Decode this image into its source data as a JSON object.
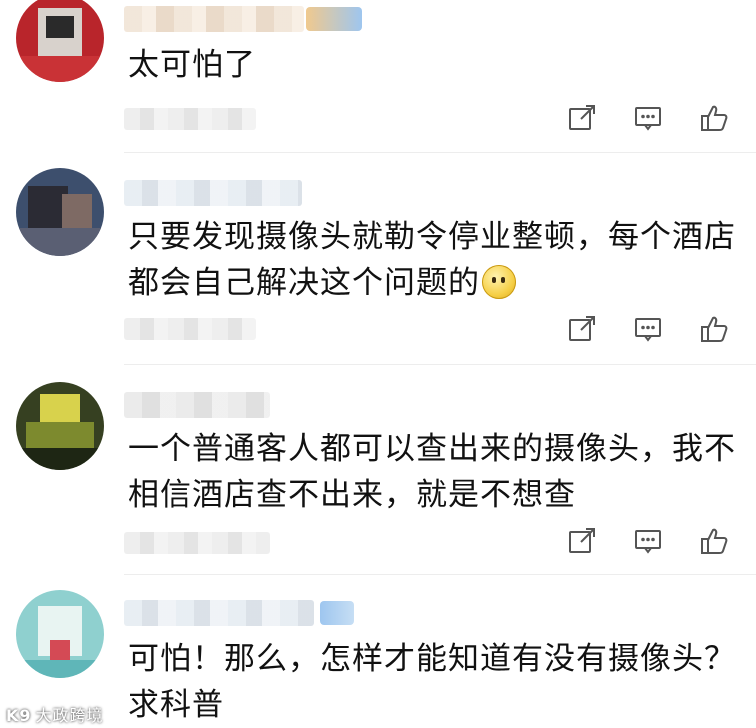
{
  "comments": [
    {
      "text": "太可怕了",
      "avatar_color": "#c7252b",
      "actions": [
        "share-icon",
        "comment-icon",
        "like-icon"
      ]
    },
    {
      "text": "只要发现摄像头就勒令停业整顿，每个酒店都会自己解决这个问题的",
      "avatar_color": "#3c4a66",
      "has_emoji": true,
      "emoji": "thinking-emoji",
      "actions": [
        "share-icon",
        "comment-icon",
        "like-icon"
      ]
    },
    {
      "text": "一个普通客人都可以查出来的摄像头，我不相信酒店查不出来，就是不想查",
      "avatar_color": "#6a7a2a",
      "actions": [
        "share-icon",
        "comment-icon",
        "like-icon"
      ]
    },
    {
      "text": "可怕！那么，怎样才能知道有没有摄像头？求科普",
      "avatar_color": "#7fc9c9",
      "actions": []
    }
  ],
  "watermark": {
    "logo": "K9",
    "text": "大政跨境"
  },
  "colors": {
    "icon": "#555555",
    "text": "#111111",
    "divider": "#ededed"
  }
}
